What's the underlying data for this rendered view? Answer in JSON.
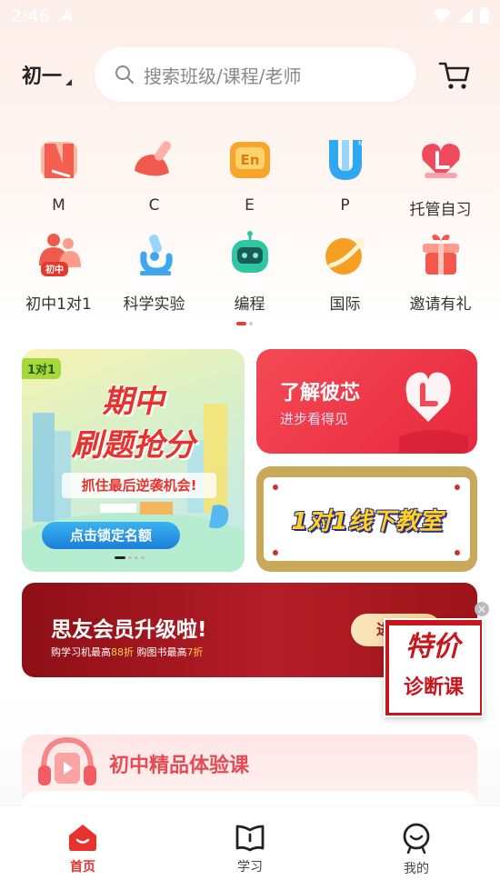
{
  "status_bar": {
    "time": "2:46",
    "notification": "A"
  },
  "header": {
    "grade": "初一",
    "search_placeholder": "搜索班级/课程/老师"
  },
  "grid": [
    {
      "label": "M",
      "icon": "math-icon",
      "color": "#f45f4f"
    },
    {
      "label": "C",
      "icon": "chinese-brush-icon",
      "color": "#f05a4e"
    },
    {
      "label": "E",
      "icon": "english-en-icon",
      "color": "#f7a62b"
    },
    {
      "label": "P",
      "icon": "physics-u-icon",
      "color": "#2ea8f0"
    },
    {
      "label": "托管自习",
      "icon": "heart-book-icon",
      "color": "#f04b5c"
    },
    {
      "label": "初中1对1",
      "icon": "junior-one-on-one-icon",
      "color": "#f05a4e",
      "badge": "初中"
    },
    {
      "label": "科学实验",
      "icon": "microscope-icon",
      "color": "#3fa6f2"
    },
    {
      "label": "编程",
      "icon": "robot-icon",
      "color": "#2fc7a2"
    },
    {
      "label": "国际",
      "icon": "globe-arrow-icon",
      "color": "#f5a022"
    },
    {
      "label": "邀请有礼",
      "icon": "gift-icon",
      "color": "#f4584b"
    }
  ],
  "banners": {
    "left": {
      "tag": "1对1",
      "title_line1": "期中",
      "title_line2": "刷题抢分",
      "subtitle": "抓住最后逆袭机会!",
      "button": "点击锁定名额"
    },
    "right_top": {
      "title": "了解彼芯",
      "subtitle": "进步看得见"
    },
    "right_bottom": {
      "text": "1对1线下教室"
    }
  },
  "vip": {
    "title": "思友会员升级啦!",
    "subtitle_prefix": "购学习机最高",
    "subtitle_v1": "88折",
    "subtitle_mid": " 购图书最高",
    "subtitle_v2": "7折",
    "button": "进"
  },
  "promo": {
    "line1": "特价",
    "line2": "诊断课"
  },
  "section": {
    "title": "初中精品体验课"
  },
  "tabbar": [
    {
      "label": "首页",
      "icon": "home-icon",
      "active": true
    },
    {
      "label": "学习",
      "icon": "study-book-icon",
      "active": false
    },
    {
      "label": "我的",
      "icon": "profile-face-icon",
      "active": false
    }
  ]
}
